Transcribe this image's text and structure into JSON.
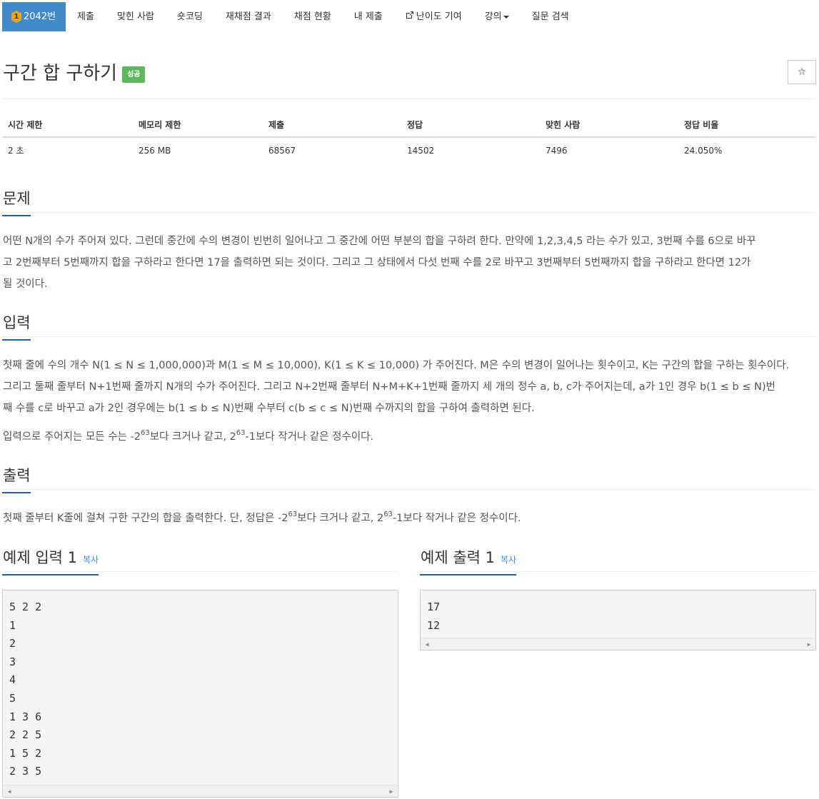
{
  "nav": {
    "problem_tier": "1",
    "problem_number": "2042번",
    "items": [
      "제출",
      "맞힌 사람",
      "숏코딩",
      "재채점 결과",
      "채점 현황",
      "내 제출"
    ],
    "difficulty_contribute": "난이도 기여",
    "lecture": "강의",
    "question_search": "질문 검색"
  },
  "title": {
    "text": "구간 합 구하기",
    "badge": "성공",
    "star": "☆"
  },
  "info": {
    "headers": [
      "시간 제한",
      "메모리 제한",
      "제출",
      "정답",
      "맞힌 사람",
      "정답 비율"
    ],
    "values": [
      "2 초",
      "256 MB",
      "68567",
      "14502",
      "7496",
      "24.050%"
    ]
  },
  "problem": {
    "title": "문제",
    "line1": "어떤 N개의 수가 주어져 있다. 그런데 중간에 수의 변경이 빈번히 일어나고 그 중간에 어떤 부분의 합을 구하려 한다. 만약에 1,2,3,4,5 라는 수가 있고, 3번째 수를 6으로 바꾸",
    "line2": "고 2번째부터 5번째까지 합을 구하라고 한다면 17을 출력하면 되는 것이다. 그리고 그 상태에서 다섯 번째 수를 2로 바꾸고 3번째부터 5번째까지 합을 구하라고 한다면 12가",
    "line3": "될 것이다."
  },
  "input": {
    "title": "입력",
    "line1": "첫째 줄에 수의 개수 N(1 ≤ N ≤ 1,000,000)과 M(1 ≤ M ≤ 10,000), K(1 ≤ K ≤ 10,000) 가 주어진다. M은 수의 변경이 일어나는 횟수이고, K는 구간의 합을 구하는 횟수이다.",
    "line2": "그리고 둘째 줄부터 N+1번째 줄까지 N개의 수가 주어진다. 그리고 N+2번째 줄부터 N+M+K+1번째 줄까지 세 개의 정수 a, b, c가 주어지는데, a가 1인 경우 b(1 ≤ b ≤ N)번",
    "line3": "째 수를 c로 바꾸고 a가 2인 경우에는 b(1 ≤ b ≤ N)번째 수부터 c(b ≤ c ≤ N)번째 수까지의 합을 구하여 출력하면 된다.",
    "range_prefix": "입력으로 주어지는 모든 수는 -2",
    "range_exp1": "63",
    "range_mid": "보다 크거나 같고, 2",
    "range_exp2": "63",
    "range_suffix": "-1보다 작거나 같은 정수이다."
  },
  "output": {
    "title": "출력",
    "prefix": "첫째 줄부터 K줄에 걸쳐 구한 구간의 합을 출력한다. 단, 정답은 -2",
    "exp1": "63",
    "mid": "보다 크거나 같고, 2",
    "exp2": "63",
    "suffix": "-1보다 작거나 같은 정수이다."
  },
  "example_input": {
    "title": "예제 입력 1",
    "copy": "복사",
    "lines": [
      "5 2 2",
      "1",
      "2",
      "3",
      "4",
      "5",
      "1 3 6",
      "2 2 5",
      "1 5 2",
      "2 3 5"
    ]
  },
  "example_output": {
    "title": "예제 출력 1",
    "copy": "복사",
    "lines": [
      "17",
      "12"
    ]
  },
  "colors": {
    "accent": "#428bca",
    "success": "#5cb85c",
    "underline": "#2a6496",
    "tier": "#e8a521"
  }
}
